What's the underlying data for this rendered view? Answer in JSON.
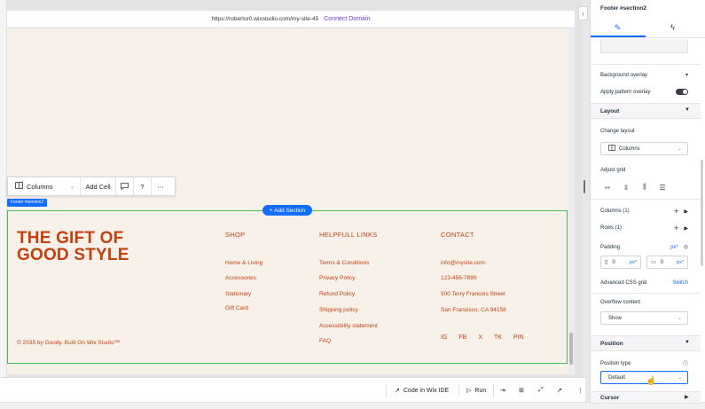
{
  "editor": {
    "url": "https://robertor0.wixstudio.com/my-site-45",
    "connect_domain": "Connect Domain"
  },
  "toolbar": {
    "columns_label": "Columns",
    "add_cell_label": "Add Cell"
  },
  "canvas": {
    "section_tag": "Footer #section2",
    "add_section": "+ Add Section"
  },
  "footer": {
    "brand_line1": "THE GIFT OF",
    "brand_line2": "GOOD STYLE",
    "copyright": "© 2035 by Goody. Built On Wix Studio™",
    "shop": {
      "heading": "SHOP",
      "links": [
        "Home & Living",
        "Accessories",
        "Stationary",
        "Gift Card"
      ]
    },
    "helpful": {
      "heading": "HELPFULL LINKS",
      "links": [
        "Terms & Conditions",
        "Privacy Policy",
        "Refund Policy",
        "Shipping policy",
        "Accessibility statement",
        "FAQ"
      ]
    },
    "contact": {
      "heading": "CONTACT",
      "lines": [
        "info@mysite.com",
        "123-456-7890",
        "500 Terry Francois Street",
        "San Francisco, CA 94158"
      ]
    },
    "social": [
      "IG",
      "FB",
      "X",
      "TK",
      "PIN"
    ]
  },
  "bottom_bar": {
    "code_label": "Code in Wix IDE",
    "run_label": "Run"
  },
  "panel": {
    "title": "Footer #section2",
    "background_overlay": "Background overlay",
    "apply_pattern_overlay": "Apply pattern overlay",
    "pattern_overlay_on": true,
    "layout_heading": "Layout",
    "change_layout": "Change layout",
    "layout_value": "Columns",
    "adjust_grid": "Adjust grid",
    "columns": "Columns (1)",
    "rows": "Rows (1)",
    "padding": "Padding",
    "padding_unit": "px*",
    "padding_values": [
      "0",
      "0"
    ],
    "advanced_css_grid": "Advanced CSS grid",
    "switch": "Switch",
    "overflow_content": "Overflow content",
    "overflow_value": "Show",
    "position_heading": "Position",
    "position_type": "Position type",
    "position_value": "Default",
    "cursor_heading": "Cursor"
  },
  "colors": {
    "accent": "#116dff",
    "brand_orange": "#c2410c",
    "selection_green": "#4bbf56",
    "site_bg": "#f7f1ea"
  }
}
